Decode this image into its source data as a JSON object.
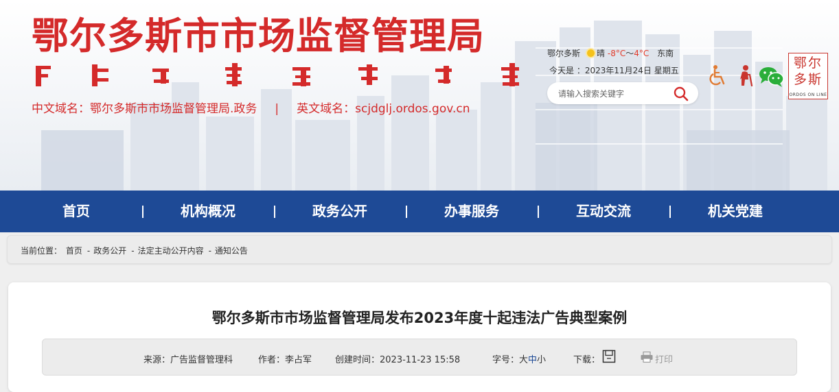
{
  "header": {
    "title": "鄂尔多斯市市场监督管理局",
    "domain_cn_label": "中文域名：",
    "domain_cn": "鄂尔多斯市市场监督管理局.政务",
    "divider": "|",
    "domain_en_label": "英文域名：",
    "domain_en": "scjdglj.ordos.gov.cn",
    "weather": {
      "city": "鄂尔多斯",
      "condition": "晴",
      "temp_low": "-8°C",
      "tilde": "～",
      "temp_high": "4°C",
      "wind": "东南"
    },
    "date": "今天是 ：2023年11月24日 星期五",
    "search_placeholder": "请输入搜索关键字",
    "seal": {
      "chars": "鄂尔多斯",
      "sub": "ORDOS ON LINE"
    }
  },
  "icons": [
    "accessibility-icon",
    "elderly-icon",
    "wechat-icon",
    "search-icon",
    "sun-icon",
    "download-icon",
    "print-icon"
  ],
  "nav": {
    "items": [
      "首页",
      "机构概况",
      "政务公开",
      "办事服务",
      "互动交流",
      "机关党建"
    ]
  },
  "breadcrumb": {
    "label": "当前位置：",
    "items": [
      "首页",
      "政务公开",
      "法定主动公开内容",
      "通知公告"
    ],
    "separator": "-"
  },
  "article": {
    "title": "鄂尔多斯市市场监督管理局发布2023年度十起违法广告典型案例",
    "source": "来源：广告监督管理科",
    "author": "作者：李占军",
    "created": "创建时间：2023-11-23 15:58",
    "font_size_label": "字号：",
    "font_large": "大",
    "font_medium": "中",
    "font_small": "小",
    "download_label": "下载：",
    "print_label": "打印"
  },
  "colors": {
    "brand_red": "#d42a2a",
    "nav_blue": "#1e4a96",
    "temp_red": "#e23b2a"
  }
}
